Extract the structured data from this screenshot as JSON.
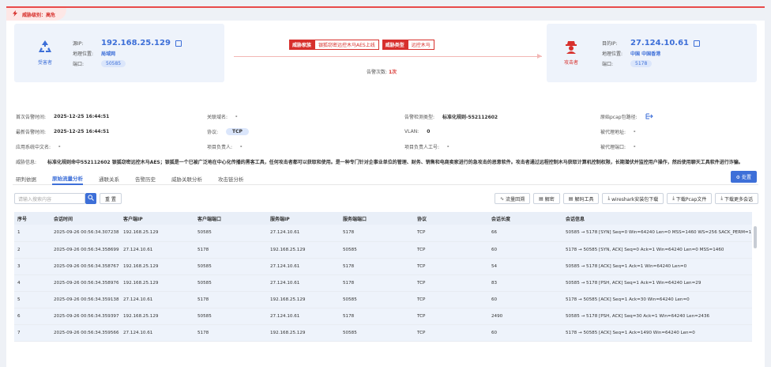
{
  "threat_level": "威胁级别：高危",
  "victim": {
    "role": "受害者",
    "ip_label": "源IP:",
    "ip": "192.168.25.129",
    "loc_label": "地理位置:",
    "loc": "局域网",
    "port_label": "端口:",
    "port": "50585"
  },
  "attacker": {
    "role": "攻击者",
    "ip_label": "目的IP:",
    "ip": "27.124.10.61",
    "loc_label": "地理位置:",
    "loc": "中国 中国香港",
    "port_label": "端口:",
    "port": "5178"
  },
  "family": {
    "label": "威胁家族",
    "value": "银狐窃密远控木马AES上线"
  },
  "type": {
    "label": "威胁类型",
    "value": "远控木马"
  },
  "alert_count": {
    "label": "告警次数:",
    "value": "1次"
  },
  "details": {
    "first_time": {
      "k": "首次告警时间:",
      "v": "2025-12-25 16:44:51"
    },
    "last_time": {
      "k": "最新告警时间:",
      "v": "2025-12-25 16:44:51"
    },
    "app_system": {
      "k": "应用系统中文名:",
      "v": "-"
    },
    "domain": {
      "k": "关联域名:",
      "v": "-"
    },
    "protocol": {
      "k": "协议:",
      "v": "TCP"
    },
    "owner": {
      "k": "项目负责人:",
      "v": "-"
    },
    "detect_type": {
      "k": "告警检测类型:",
      "v": "标准化规则-552112602"
    },
    "vlan": {
      "k": "VLAN:",
      "v": "0"
    },
    "owner_id": {
      "k": "项目负责人工号:",
      "v": "-"
    },
    "pcap_path": {
      "k": "原始pcap包路径:"
    },
    "proxy_addr": {
      "k": "被代理地址:",
      "v": "-"
    },
    "proxy_port": {
      "k": "被代理端口:",
      "v": "-"
    },
    "threat_info": {
      "k": "威胁信息:",
      "v": "标准化规则命中552112602 银狐窃密远控木马AES；银狐是一个已被广泛地在中心化传播的黑客工具，任何攻击者都可以获取和使用。是一种专门针对企事业单位的管理、财务、销售和电商卖家进行的急攻击的恶意软件。攻击者通过远程控制木马获取计算机控制权限，长期潜伏并监控用户操作，然后使用聊天工具软件进行诈骗。"
    }
  },
  "tabs": [
    "研判依据",
    "原始流量分析",
    "通联关系",
    "告警历史",
    "威胁关联分析",
    "攻击链分析"
  ],
  "dispose_btn": "处置",
  "search": {
    "placeholder": "请输入搜索内容",
    "reset": "重 置"
  },
  "actions": [
    "流量回溯",
    "解密",
    "解码工具",
    "wireshark安装包下载",
    "下载Pcap文件",
    "下载更多会话"
  ],
  "table": {
    "headers": [
      "序号",
      "会话时间",
      "客户端IP",
      "客户端端口",
      "服务端IP",
      "服务端端口",
      "协议",
      "会话长度",
      "会话信息"
    ],
    "rows": [
      [
        "1",
        "2025-09-26 00:56:34.307238",
        "192.168.25.129",
        "50585",
        "27.124.10.61",
        "5178",
        "TCP",
        "66",
        "50585 → 5178 [SYN] Seq=0 Win=64240 Len=0 MSS=1460 WS=256 SACK_PERM=1"
      ],
      [
        "2",
        "2025-09-26 00:56:34.358699",
        "27.124.10.61",
        "5178",
        "192.168.25.129",
        "50585",
        "TCP",
        "60",
        "5178 → 50585 [SYN, ACK] Seq=0 Ack=1 Win=64240 Len=0 MSS=1460"
      ],
      [
        "3",
        "2025-09-26 00:56:34.358767",
        "192.168.25.129",
        "50585",
        "27.124.10.61",
        "5178",
        "TCP",
        "54",
        "50585 → 5178 [ACK] Seq=1 Ack=1 Win=64240 Len=0"
      ],
      [
        "4",
        "2025-09-26 00:56:34.358976",
        "192.168.25.129",
        "50585",
        "27.124.10.61",
        "5178",
        "TCP",
        "83",
        "50585 → 5178 [PSH, ACK] Seq=1 Ack=1 Win=64240 Len=29"
      ],
      [
        "5",
        "2025-09-26 00:56:34.359138",
        "27.124.10.61",
        "5178",
        "192.168.25.129",
        "50585",
        "TCP",
        "60",
        "5178 → 50585 [ACK] Seq=1 Ack=30 Win=64240 Len=0"
      ],
      [
        "6",
        "2025-09-26 00:56:34.359397",
        "192.168.25.129",
        "50585",
        "27.124.10.61",
        "5178",
        "TCP",
        "2490",
        "50585 → 5178 [PSH, ACK] Seq=30 Ack=1 Win=64240 Len=2436"
      ],
      [
        "7",
        "2025-09-26 00:56:34.359566",
        "27.124.10.61",
        "5178",
        "192.168.25.129",
        "50585",
        "TCP",
        "60",
        "5178 → 50585 [ACK] Seq=1 Ack=1490 Win=64240 Len=0"
      ]
    ]
  }
}
